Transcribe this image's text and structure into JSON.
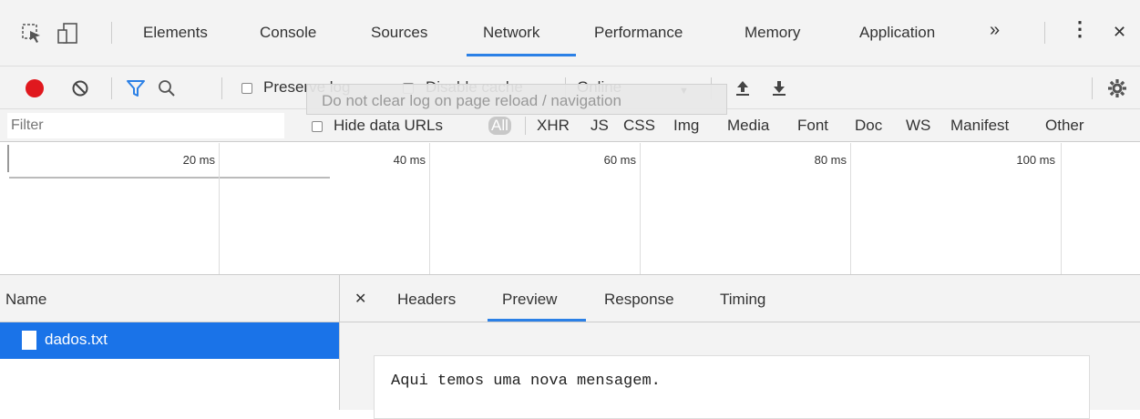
{
  "tabbar": {
    "tabs": [
      "Elements",
      "Console",
      "Sources",
      "Network",
      "Performance",
      "Memory",
      "Application"
    ],
    "active_tab": "Network",
    "more_glyph": "»",
    "menu_glyph": "⋮",
    "close_glyph": "✕"
  },
  "toolbar": {
    "preserve_log": "Preserve log",
    "disable_cache": "Disable cache",
    "throttle_value": "Online",
    "dropdown_glyph": "▼",
    "record_color": "#e0181e",
    "filter_active_color": "#2b80e6"
  },
  "tooltip": "Do not clear log on page reload / navigation",
  "filter": {
    "placeholder": "Filter",
    "hide_data_urls": "Hide data URLs",
    "types": [
      "All",
      "XHR",
      "JS",
      "CSS",
      "Img",
      "Media",
      "Font",
      "Doc",
      "WS",
      "Manifest",
      "Other"
    ]
  },
  "timeline": {
    "ticks": [
      "20 ms",
      "40 ms",
      "60 ms",
      "80 ms",
      "100 ms"
    ]
  },
  "requests": {
    "name_header": "Name",
    "rows": [
      {
        "name": "dados.txt",
        "selected": true
      }
    ]
  },
  "details": {
    "close_glyph": "✕",
    "tabs": [
      "Headers",
      "Preview",
      "Response",
      "Timing"
    ],
    "active_tab": "Preview",
    "preview_text": "Aqui temos uma nova mensagem."
  },
  "colors": {
    "selection": "#1a73e8",
    "accent": "#2b80e6",
    "panel_bg": "#f3f3f3"
  }
}
